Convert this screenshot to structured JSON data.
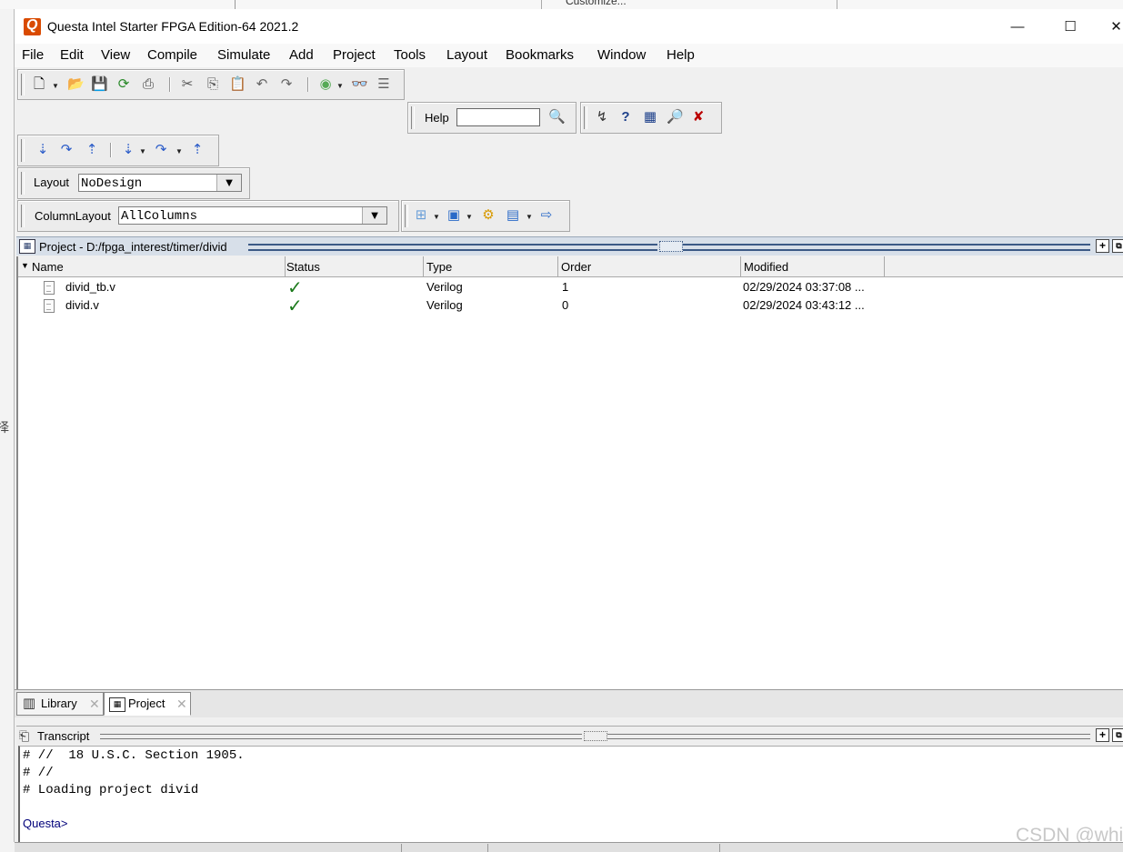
{
  "window": {
    "title": "Questa Intel Starter FPGA Edition-64 2021.2",
    "controls": {
      "minimize": "—",
      "maximize": "☐",
      "close": "✕"
    }
  },
  "background": {
    "tab_text": "Customize...",
    "side_char": "择"
  },
  "menu": [
    "File",
    "Edit",
    "View",
    "Compile",
    "Simulate",
    "Add",
    "Project",
    "Tools",
    "Layout",
    "Bookmarks",
    "Window",
    "Help"
  ],
  "toolbar": {
    "help_label": "Help",
    "help_value": "",
    "layout_label": "Layout",
    "layout_value": "NoDesign",
    "column_layout_label": "ColumnLayout",
    "column_layout_value": "AllColumns"
  },
  "project_pane": {
    "title": "Project - D:/fpga_interest/timer/divid",
    "columns": [
      "Name",
      "Status",
      "Type",
      "Order",
      "Modified"
    ],
    "rows": [
      {
        "name": "divid_tb.v",
        "status": "✓",
        "type": "Verilog",
        "order": "1",
        "modified": "02/29/2024 03:37:08 ..."
      },
      {
        "name": "divid.v",
        "status": "✓",
        "type": "Verilog",
        "order": "0",
        "modified": "02/29/2024 03:43:12 ..."
      }
    ]
  },
  "tabs": [
    {
      "label": "Library",
      "close": "✕"
    },
    {
      "label": "Project",
      "close": "✕"
    }
  ],
  "transcript": {
    "title": "Transcript",
    "lines": [
      "# //  18 U.S.C. Section 1905.",
      "# //",
      "# Loading project divid"
    ],
    "prompt": "Questa>"
  },
  "watermark": "CSDN @whi",
  "colors": {
    "app_logo": "#d94a00",
    "pane_header": "#d7dfe9",
    "check": "#1c7a1c",
    "prompt": "#00007a"
  }
}
